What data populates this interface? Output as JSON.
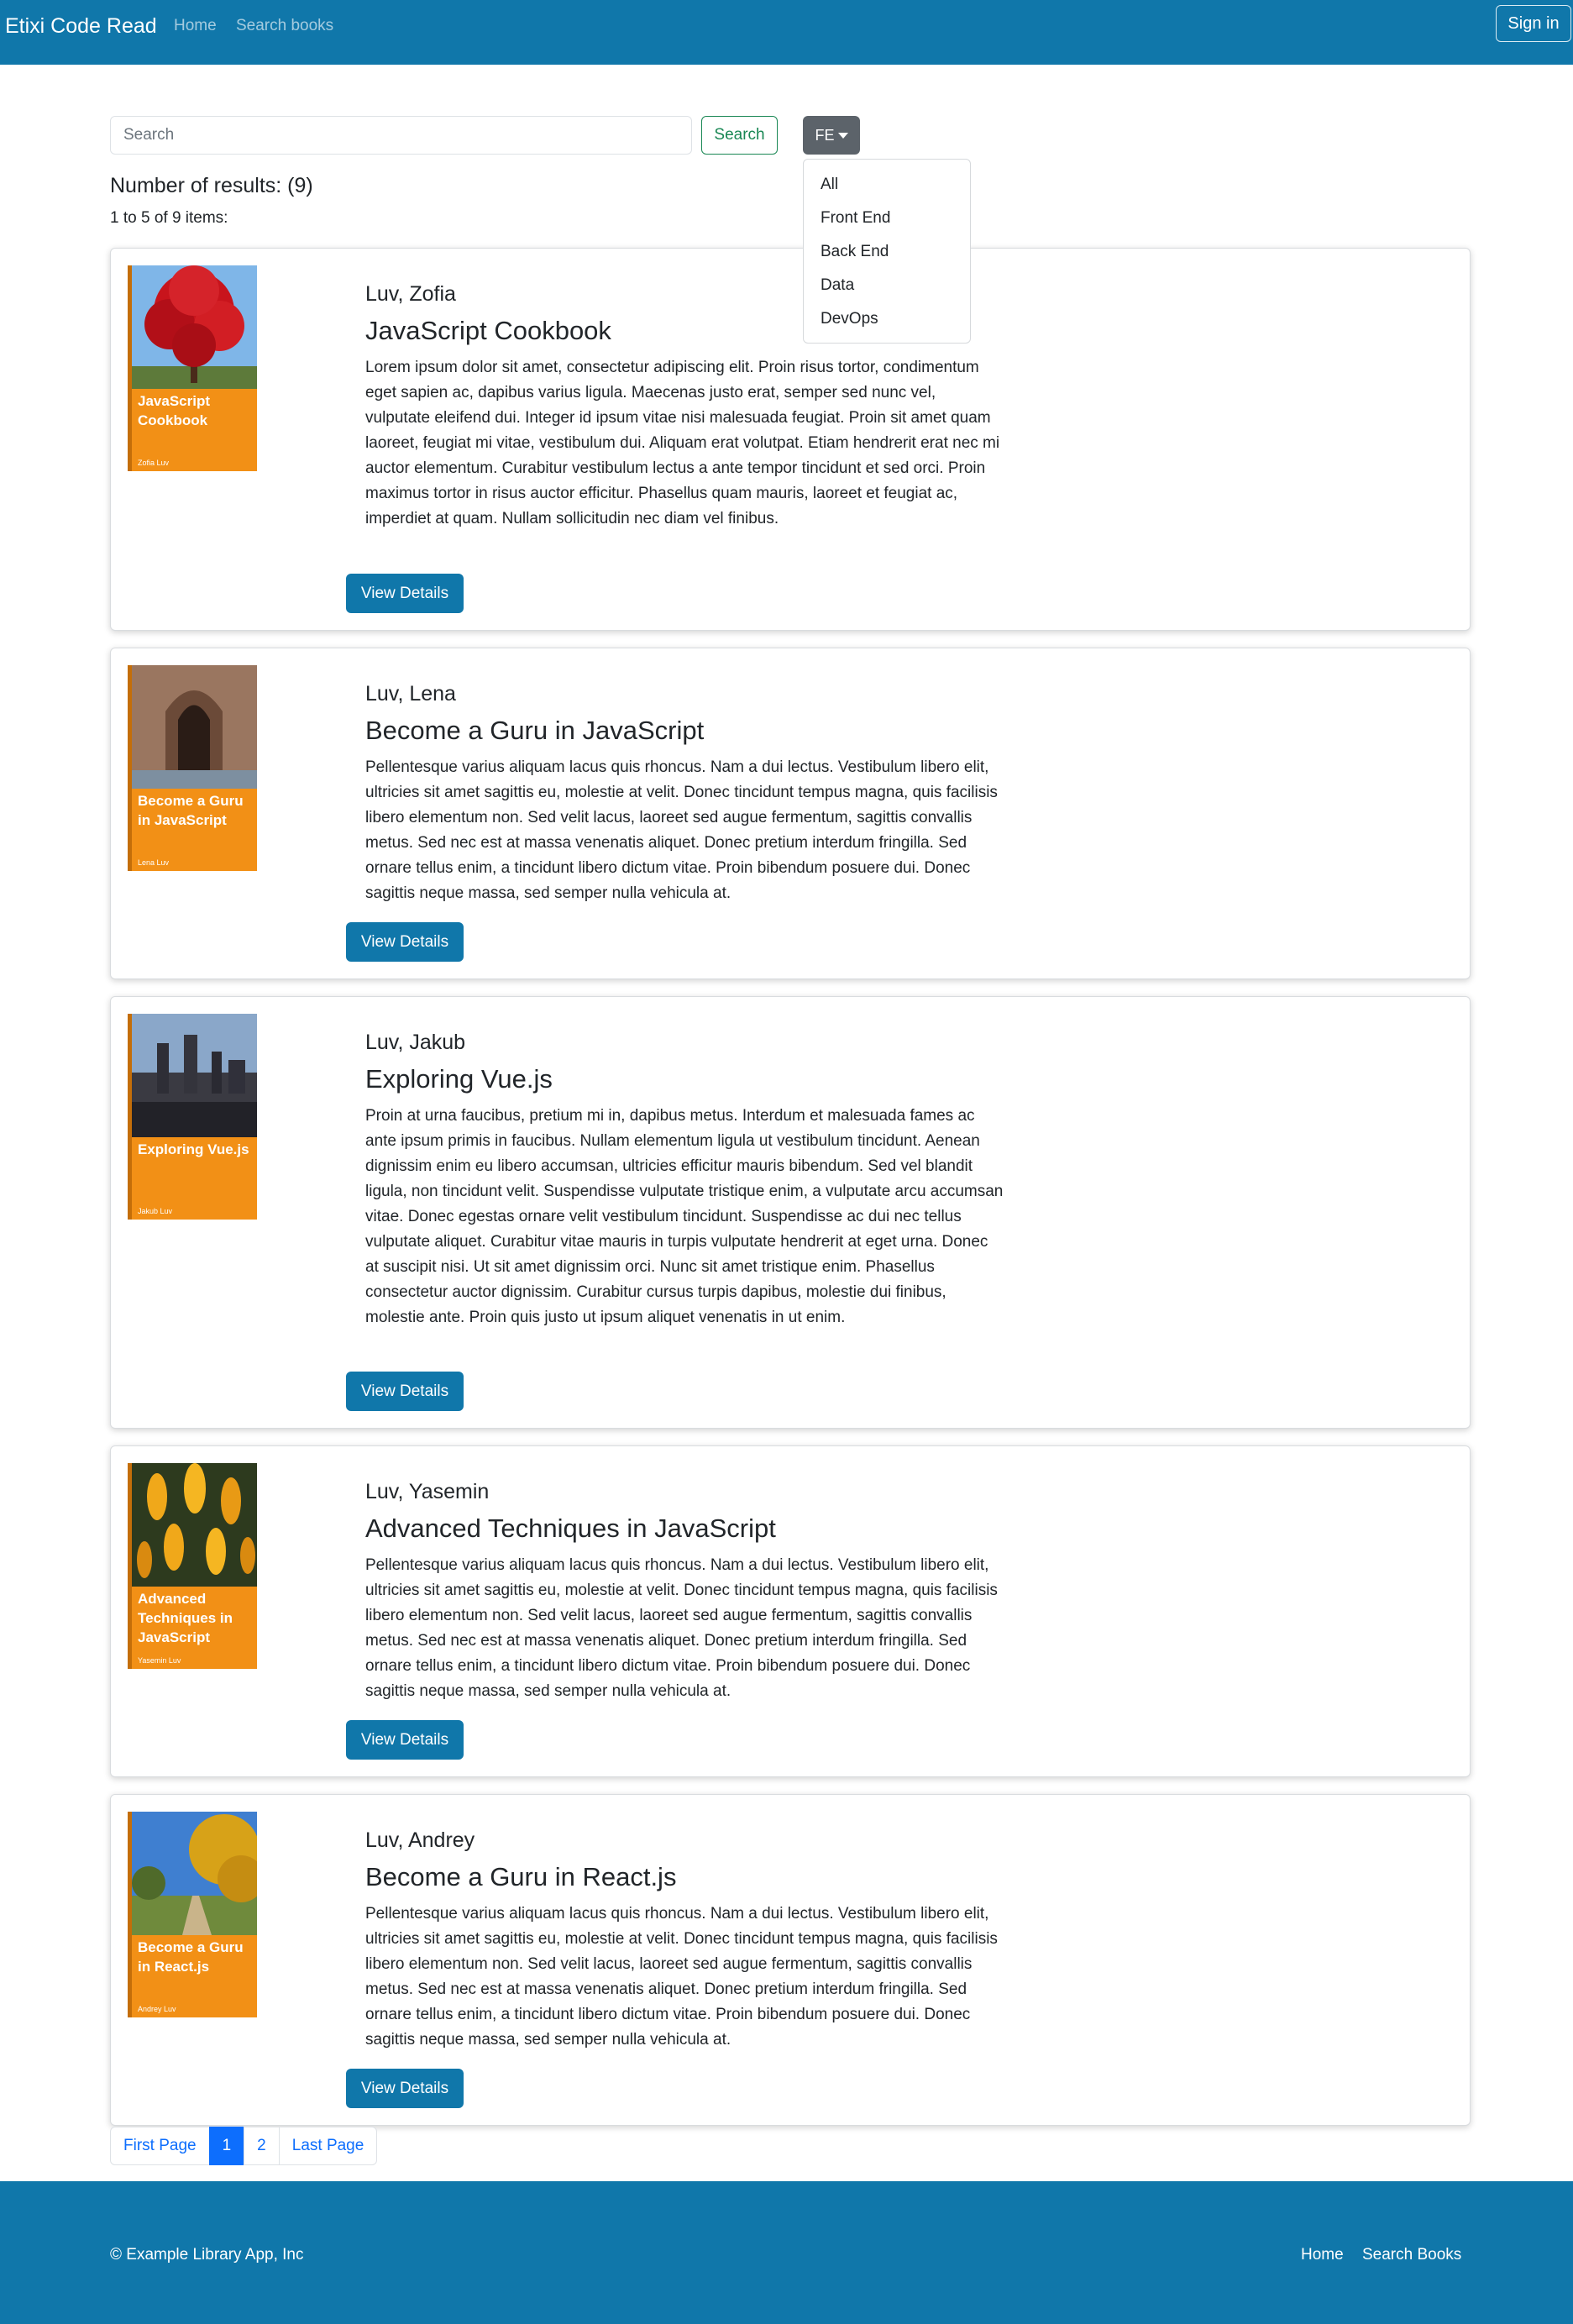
{
  "navbar": {
    "brand": "Etixi Code Read",
    "links": [
      "Home",
      "Search books"
    ],
    "signin_label": "Sign in"
  },
  "search": {
    "placeholder": "Search",
    "value": "",
    "button_label": "Search"
  },
  "category_filter": {
    "selected": "FE",
    "options": [
      "All",
      "Front End",
      "Back End",
      "Data",
      "DevOps"
    ]
  },
  "results": {
    "count_text": "Number of results: (9)",
    "range_text": "1 to 5 of 9 items:"
  },
  "books": [
    {
      "author": "Luv, Zofia",
      "title": "JavaScript Cookbook",
      "description": "Lorem ipsum dolor sit amet, consectetur adipiscing elit. Proin risus tortor, condimentum eget sapien ac, dapibus varius ligula. Maecenas justo erat, semper sed nunc vel, vulputate eleifend dui. Integer id ipsum vitae nisi malesuada feugiat. Proin sit amet quam laoreet, feugiat mi vitae, vestibulum dui. Aliquam erat volutpat. Etiam hendrerit erat nec mi auctor elementum. Curabitur vestibulum lectus a ante tempor tincidunt et sed orci. Proin maximus tortor in risus auctor efficitur. Phasellus quam mauris, laoreet et feugiat ac, imperdiet at quam. Nullam sollicitudin nec diam vel finibus.",
      "cover_title": "JavaScript Cookbook",
      "cover_author": "Zofia Luv",
      "button_label": "View Details"
    },
    {
      "author": "Luv, Lena",
      "title": "Become a Guru in JavaScript",
      "description": "Pellentesque varius aliquam lacus quis rhoncus. Nam a dui lectus. Vestibulum libero elit, ultricies sit amet sagittis eu, molestie at velit. Donec tincidunt tempus magna, quis facilisis libero elementum non. Sed velit lacus, laoreet sed augue fermentum, sagittis convallis metus. Sed nec est at massa venenatis aliquet. Donec pretium interdum fringilla. Sed ornare tellus enim, a tincidunt libero dictum vitae. Proin bibendum posuere dui. Donec sagittis neque massa, sed semper nulla vehicula at.",
      "cover_title": "Become a Guru in JavaScript",
      "cover_author": "Lena Luv",
      "button_label": "View Details"
    },
    {
      "author": "Luv, Jakub",
      "title": "Exploring Vue.js",
      "description": "Proin at urna faucibus, pretium mi in, dapibus metus. Interdum et malesuada fames ac ante ipsum primis in faucibus. Nullam elementum ligula ut vestibulum tincidunt. Aenean dignissim enim eu libero accumsan, ultricies efficitur mauris bibendum. Sed vel blandit ligula, non tincidunt velit. Suspendisse vulputate tristique enim, a vulputate arcu accumsan vitae. Donec egestas ornare velit vestibulum tincidunt. Suspendisse ac dui nec tellus vulputate aliquet. Curabitur vitae mauris in turpis vulputate hendrerit at eget urna. Donec at suscipit nisi. Ut sit amet dignissim orci. Nunc sit amet tristique enim. Phasellus consectetur auctor dignissim. Curabitur cursus turpis dapibus, molestie dui finibus, molestie ante. Proin quis justo ut ipsum aliquet venenatis in ut enim.",
      "cover_title": "Exploring Vue.js",
      "cover_author": "Jakub Luv",
      "button_label": "View Details"
    },
    {
      "author": "Luv, Yasemin",
      "title": "Advanced Techniques in JavaScript",
      "description": "Pellentesque varius aliquam lacus quis rhoncus. Nam a dui lectus. Vestibulum libero elit, ultricies sit amet sagittis eu, molestie at velit. Donec tincidunt tempus magna, quis facilisis libero elementum non. Sed velit lacus, laoreet sed augue fermentum, sagittis convallis metus. Sed nec est at massa venenatis aliquet. Donec pretium interdum fringilla. Sed ornare tellus enim, a tincidunt libero dictum vitae. Proin bibendum posuere dui. Donec sagittis neque massa, sed semper nulla vehicula at.",
      "cover_title": "Advanced Techniques in JavaScript",
      "cover_author": "Yasemin Luv",
      "button_label": "View Details"
    },
    {
      "author": "Luv, Andrey",
      "title": "Become a Guru in React.js",
      "description": "Pellentesque varius aliquam lacus quis rhoncus. Nam a dui lectus. Vestibulum libero elit, ultricies sit amet sagittis eu, molestie at velit. Donec tincidunt tempus magna, quis facilisis libero elementum non. Sed velit lacus, laoreet sed augue fermentum, sagittis convallis metus. Sed nec est at massa venenatis aliquet. Donec pretium interdum fringilla. Sed ornare tellus enim, a tincidunt libero dictum vitae. Proin bibendum posuere dui. Donec sagittis neque massa, sed semper nulla vehicula at.",
      "cover_title": "Become a Guru in React.js",
      "cover_author": "Andrey Luv",
      "button_label": "View Details"
    }
  ],
  "pagination": {
    "first_label": "First Page",
    "pages": [
      "1",
      "2"
    ],
    "active_page": "1",
    "last_label": "Last Page"
  },
  "footer": {
    "copyright": "© Example Library App, Inc",
    "links": [
      "Home",
      "Search Books"
    ]
  },
  "colors": {
    "primary": "#1077aa",
    "success": "#198754",
    "secondary": "#5c636a",
    "link": "#0d6efd",
    "cover_orange": "#f29016"
  }
}
